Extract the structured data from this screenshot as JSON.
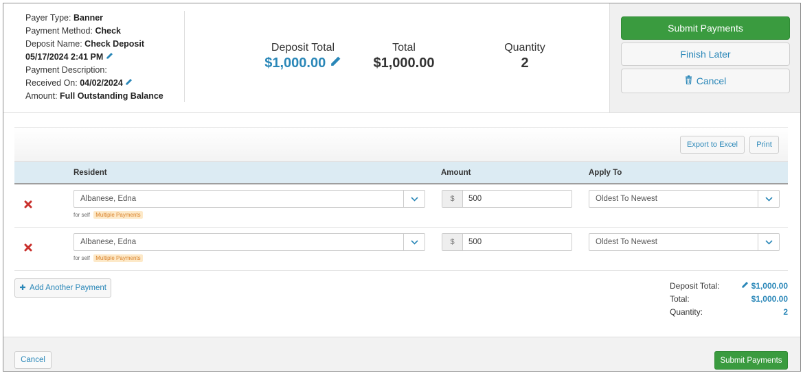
{
  "payment_info": {
    "payer_type_label": "Payer Type:",
    "payer_type_value": "Banner",
    "payment_method_label": "Payment Method:",
    "payment_method_value": "Check",
    "deposit_name_label": "Deposit Name:",
    "deposit_name_value": "Check Deposit",
    "deposit_datetime": "05/17/2024 2:41 PM",
    "payment_description_label": "Payment Description:",
    "received_on_label": "Received On:",
    "received_on_value": "04/02/2024",
    "amount_label": "Amount:",
    "amount_value": "Full Outstanding Balance"
  },
  "totals": {
    "deposit_total_label": "Deposit Total",
    "deposit_total_value": "$1,000.00",
    "total_label": "Total",
    "total_value": "$1,000.00",
    "quantity_label": "Quantity",
    "quantity_value": "2"
  },
  "actions": {
    "submit_label": "Submit Payments",
    "finish_later_label": "Finish Later",
    "cancel_label": "Cancel"
  },
  "toolbar": {
    "export_label": "Export to Excel",
    "print_label": "Print"
  },
  "table": {
    "columns": [
      "Resident",
      "Amount",
      "Apply To"
    ],
    "rows": [
      {
        "resident": "Albanese, Edna",
        "for_text": "for self",
        "badge": "Multiple Payments",
        "currency": "$",
        "amount": "500",
        "apply_to": "Oldest To Newest"
      },
      {
        "resident": "Albanese, Edna",
        "for_text": "for self",
        "badge": "Multiple Payments",
        "currency": "$",
        "amount": "500",
        "apply_to": "Oldest To Newest"
      }
    ]
  },
  "add_payment_label": "Add Another Payment",
  "summary": {
    "deposit_total_label": "Deposit Total:",
    "deposit_total_value": "$1,000.00",
    "total_label": "Total:",
    "total_value": "$1,000.00",
    "quantity_label": "Quantity:",
    "quantity_value": "2"
  },
  "footer": {
    "cancel_label": "Cancel",
    "submit_label": "Submit Payments"
  },
  "colors": {
    "accent_blue": "#2a87b8",
    "success_green": "#3a9b3f",
    "delete_red": "#c9302c",
    "table_header_bg": "#dcebf3"
  },
  "icons": [
    "pencil-icon",
    "trash-icon",
    "delete-x-icon",
    "chevron-down-icon",
    "plus-icon"
  ]
}
